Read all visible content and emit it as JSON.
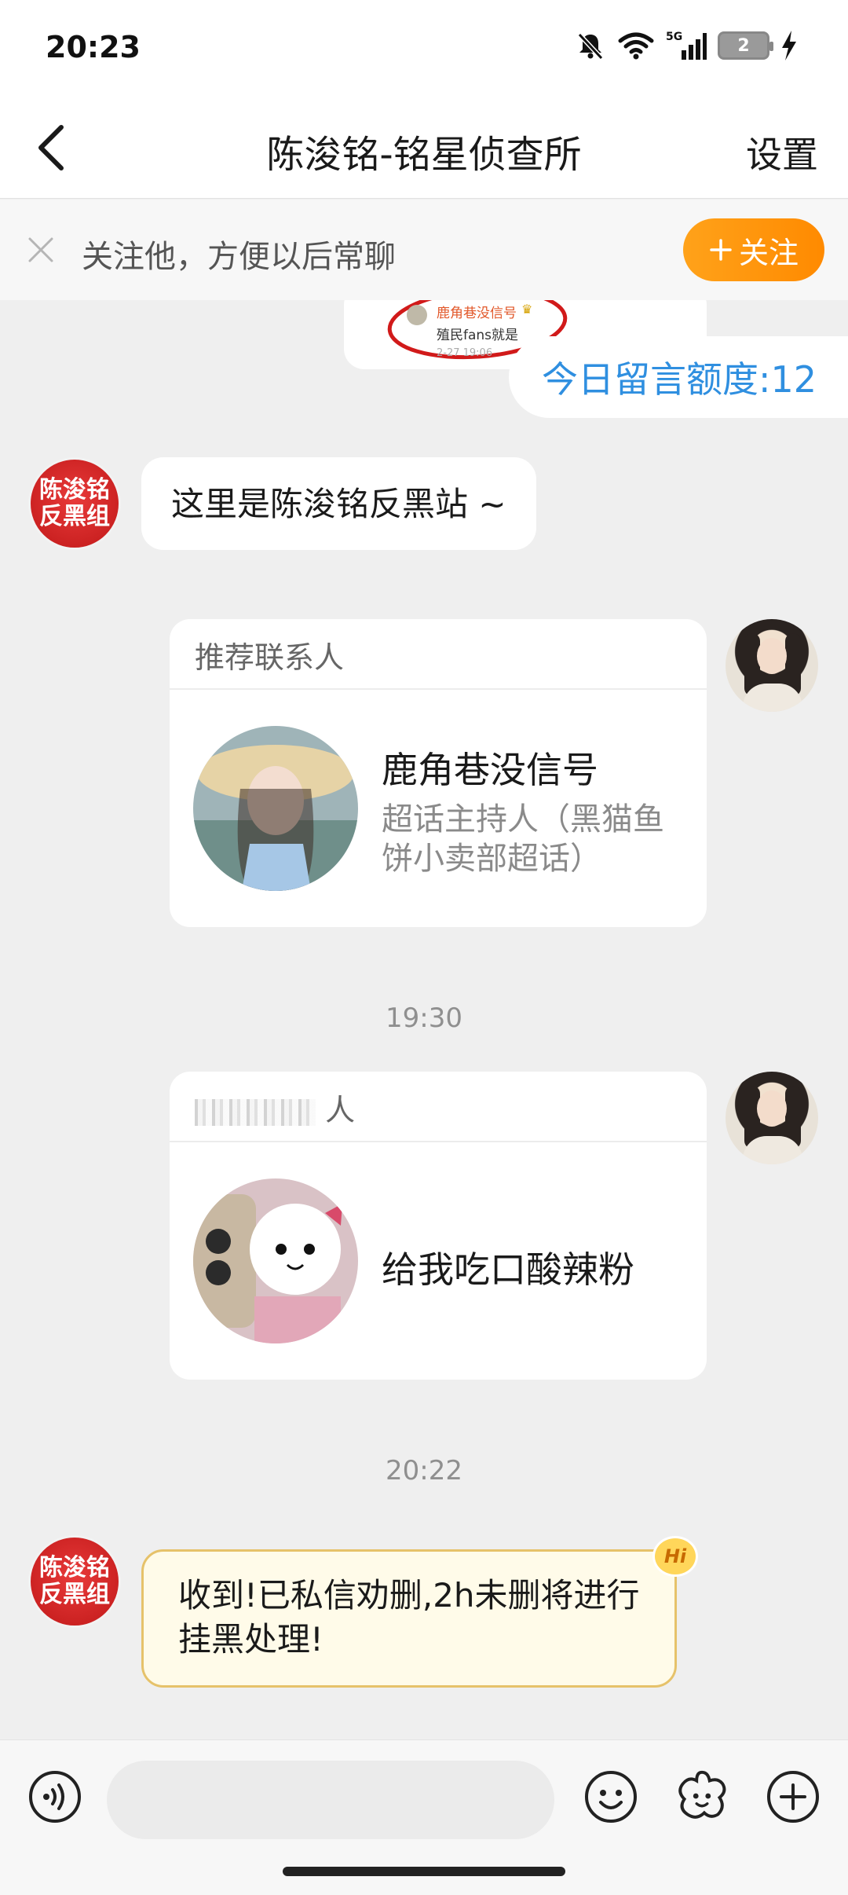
{
  "status_bar": {
    "time": "20:23",
    "network": "5G",
    "battery_level": "2"
  },
  "header": {
    "title": "陈浚铭-铭星侦查所",
    "settings_label": "设置"
  },
  "follow_banner": {
    "text": "关注他，方便以后常聊",
    "button_label": "关注"
  },
  "messages": {
    "forwarded_image": {
      "name": "鹿角巷没信号",
      "text": "殖民fans就是",
      "time": "2-27 19:06"
    },
    "quota": "今日留言额度:12",
    "msg1": {
      "text": "这里是陈浚铭反黑站 ~"
    },
    "avatar_text": {
      "line1": "陈浚铭",
      "line2": "反黑组"
    },
    "card1": {
      "header": "推荐联系人",
      "name": "鹿角巷没信号",
      "description": "超话主持人（黑猫鱼饼小卖部超话）"
    },
    "time1": "19:30",
    "card2": {
      "header_visible": "人",
      "message": "给我吃口酸辣粉"
    },
    "time2": "20:22",
    "msg2": {
      "text": "收到!已私信劝删,2h未删将进行挂黑处理!",
      "badge": "Hi"
    }
  },
  "colors": {
    "accent_orange": "#ff9a0e",
    "quota_blue": "#2f8fe0",
    "avatar_red": "#d42424",
    "system_bubble_bg": "#fffbe9"
  },
  "icons": [
    "back-icon",
    "close-icon",
    "plus-icon",
    "voice-icon",
    "emoji-icon",
    "sticker-icon",
    "add-icon"
  ]
}
